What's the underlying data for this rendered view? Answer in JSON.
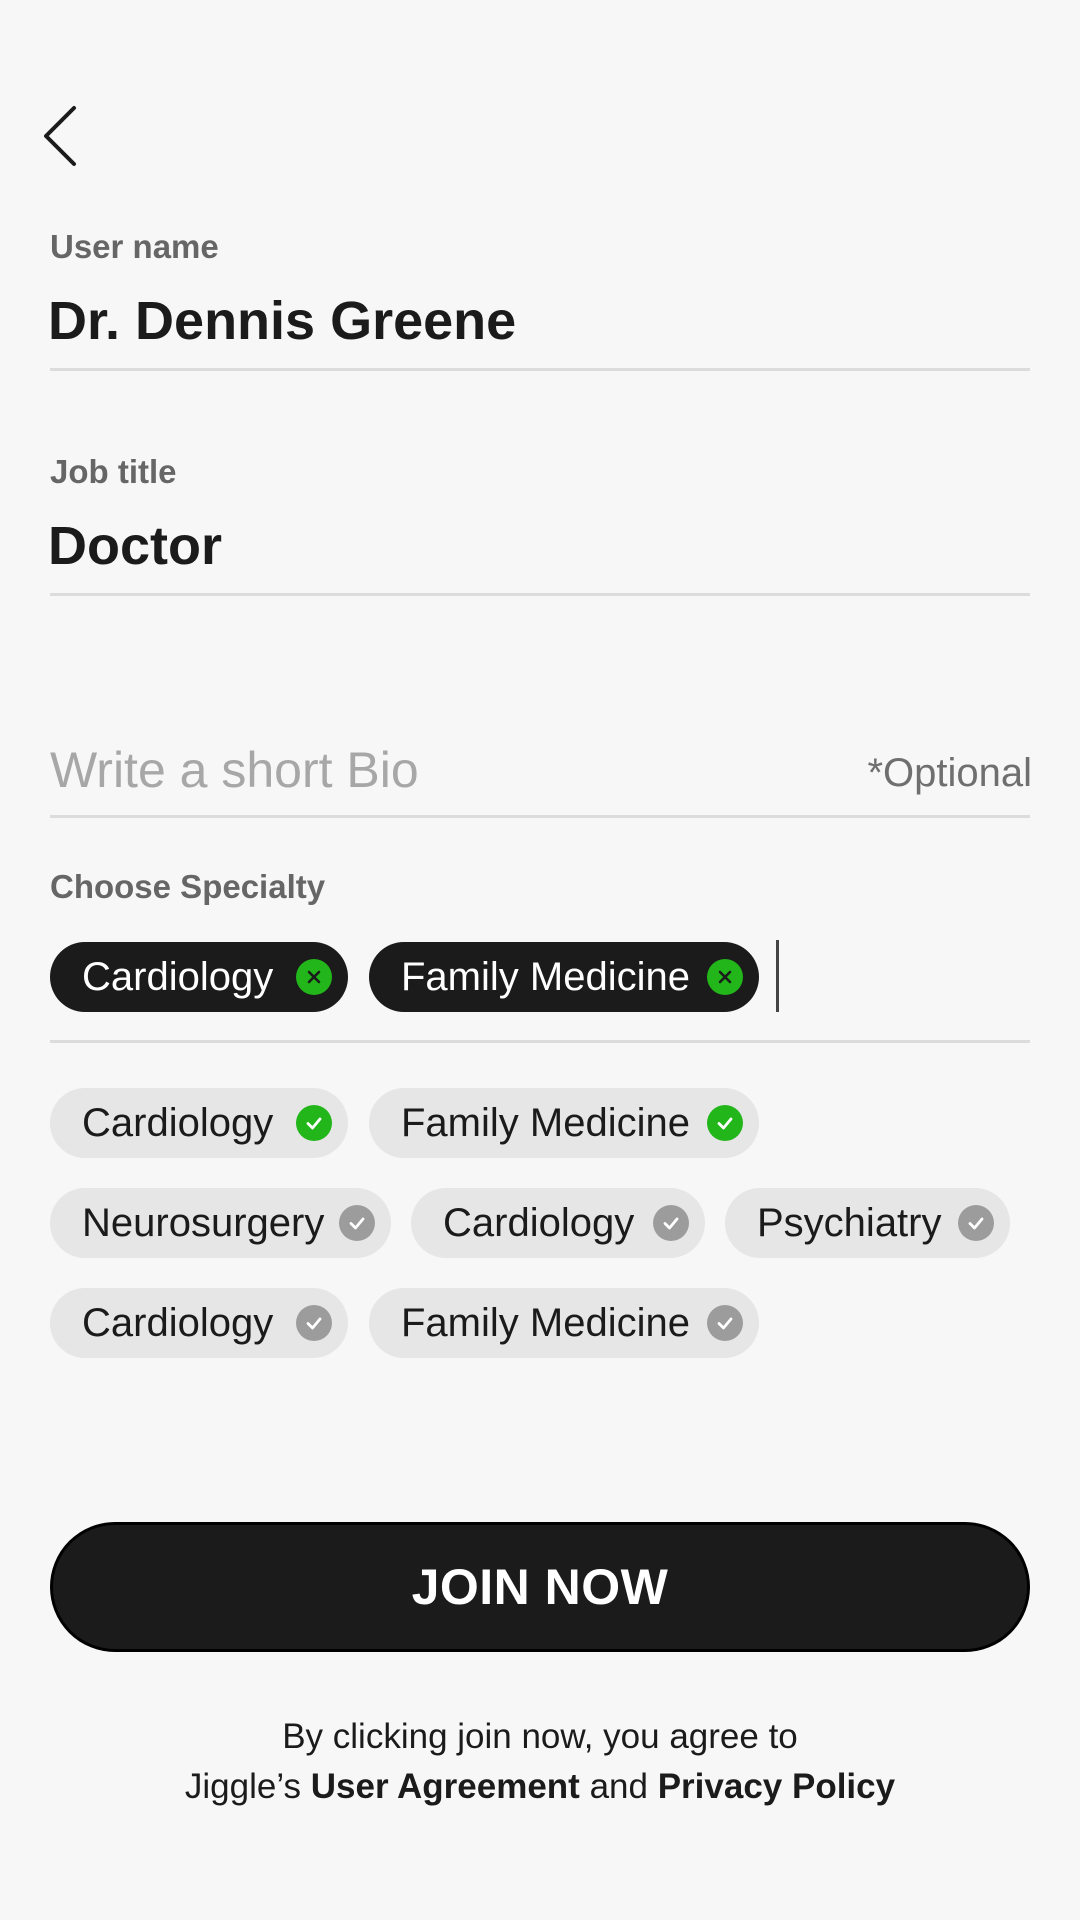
{
  "username": {
    "label": "User name",
    "value": "Dr. Dennis Greene"
  },
  "job_title": {
    "label": "Job title",
    "value": "Doctor"
  },
  "bio": {
    "placeholder": "Write a short Bio",
    "optional_label": "*Optional"
  },
  "specialty": {
    "label": "Choose Specialty",
    "selected": [
      {
        "label": "Cardiology",
        "icon": "remove-icon"
      },
      {
        "label": "Family Medicine",
        "icon": "remove-icon"
      }
    ],
    "options": [
      {
        "label": "Cardiology",
        "checked": true
      },
      {
        "label": "Family Medicine",
        "checked": true
      },
      {
        "label": "Neurosurgery",
        "checked": false
      },
      {
        "label": "Cardiology",
        "checked": false
      },
      {
        "label": "Psychiatry",
        "checked": false
      },
      {
        "label": "Cardiology",
        "checked": false
      },
      {
        "label": "Family Medicine",
        "checked": false
      }
    ]
  },
  "join_button": {
    "label": "JOIN NOW"
  },
  "legal": {
    "line1": "By clicking join now, you agree to",
    "prefix": "Jiggle’s",
    "user_agreement": "User Agreement",
    "and": "and",
    "privacy_policy": "Privacy Policy"
  },
  "colors": {
    "accent_green": "#22b61b",
    "dark": "#1b1b1b",
    "chip_light": "#e6e6e6",
    "check_grey": "#9c9c9c",
    "background": "#f7f7f7"
  }
}
